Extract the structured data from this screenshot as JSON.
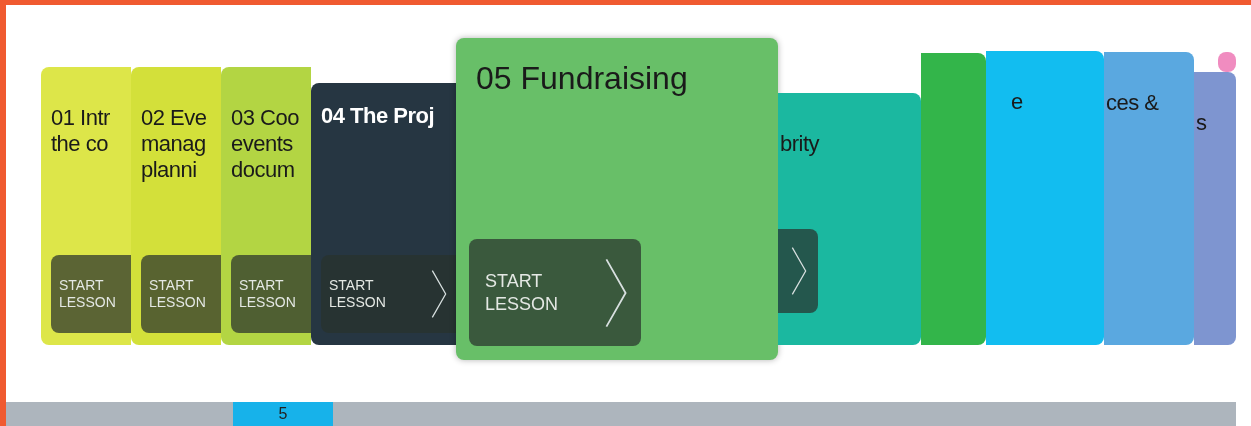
{
  "cards": [
    {
      "title_lines": [
        "01 Intr",
        "the co"
      ],
      "color": "#dde649",
      "selected": false,
      "button": {
        "label_lines": [
          "START",
          "LESSON"
        ],
        "chevron": false
      }
    },
    {
      "title_lines": [
        "02 Eve",
        "manag",
        "planni"
      ],
      "color": "#d3e03a",
      "selected": false,
      "button": {
        "label_lines": [
          "START",
          "LESSON"
        ],
        "chevron": false
      }
    },
    {
      "title_lines": [
        "03 Coo",
        "events",
        "docum"
      ],
      "color": "#b3d543",
      "selected": false,
      "button": {
        "label_lines": [
          "START",
          "LESSON"
        ],
        "chevron": false
      }
    },
    {
      "title_lines": [
        "04 The Proj"
      ],
      "color": "#263642",
      "selected": false,
      "button": {
        "label_lines": [
          "START",
          "LESSON"
        ],
        "chevron": true
      }
    },
    {
      "title_lines": [
        "05 Fundraising"
      ],
      "color": "#68bf68",
      "selected": true,
      "button": {
        "label_lines": [
          "START",
          "LESSON"
        ],
        "chevron": true
      }
    },
    {
      "title_lines": [
        "brity"
      ],
      "color": "#1bb8a0",
      "selected": false,
      "button": {
        "chevron": true
      }
    },
    {
      "color": "#33b54a",
      "selected": false
    },
    {
      "title_lines": [
        "e"
      ],
      "color": "#12bdf0",
      "selected": false
    },
    {
      "title_lines": [
        "ces &"
      ],
      "color": "#5aa8e0",
      "selected": false
    },
    {
      "title_lines": [
        "s"
      ],
      "color": "#7e95d0",
      "selected": false
    },
    {
      "color": "#f08cc0",
      "selected": false
    }
  ],
  "pager": {
    "label": "5"
  }
}
